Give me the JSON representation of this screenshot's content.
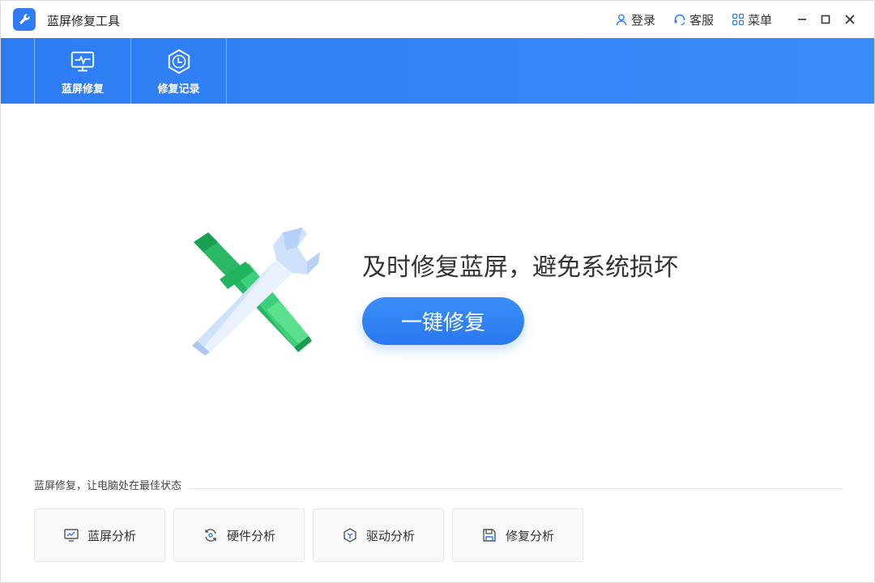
{
  "app": {
    "title": "蓝屏修复工具",
    "icon": "wrench-icon",
    "accent": "#2f7cf6"
  },
  "titlebar": {
    "login": {
      "label": "登录",
      "icon": "user-icon"
    },
    "service": {
      "label": "客服",
      "icon": "headset-icon"
    },
    "menu": {
      "label": "菜单",
      "icon": "grid-icon"
    }
  },
  "nav": {
    "items": [
      {
        "label": "蓝屏修复",
        "icon": "monitor-pulse-icon"
      },
      {
        "label": "修复记录",
        "icon": "clock-hexagon-icon"
      }
    ]
  },
  "hero": {
    "title": "及时修复蓝屏，避免系统损坏",
    "button_label": "一键修复",
    "illustration": "wrench-screwdriver-icon"
  },
  "bottom": {
    "section_title": "蓝屏修复，让电脑处在最佳状态",
    "tools": [
      {
        "label": "蓝屏分析",
        "icon": "chart-monitor-icon"
      },
      {
        "label": "硬件分析",
        "icon": "refresh-gear-icon"
      },
      {
        "label": "驱动分析",
        "icon": "cube-icon"
      },
      {
        "label": "修复分析",
        "icon": "save-disk-icon"
      }
    ]
  }
}
